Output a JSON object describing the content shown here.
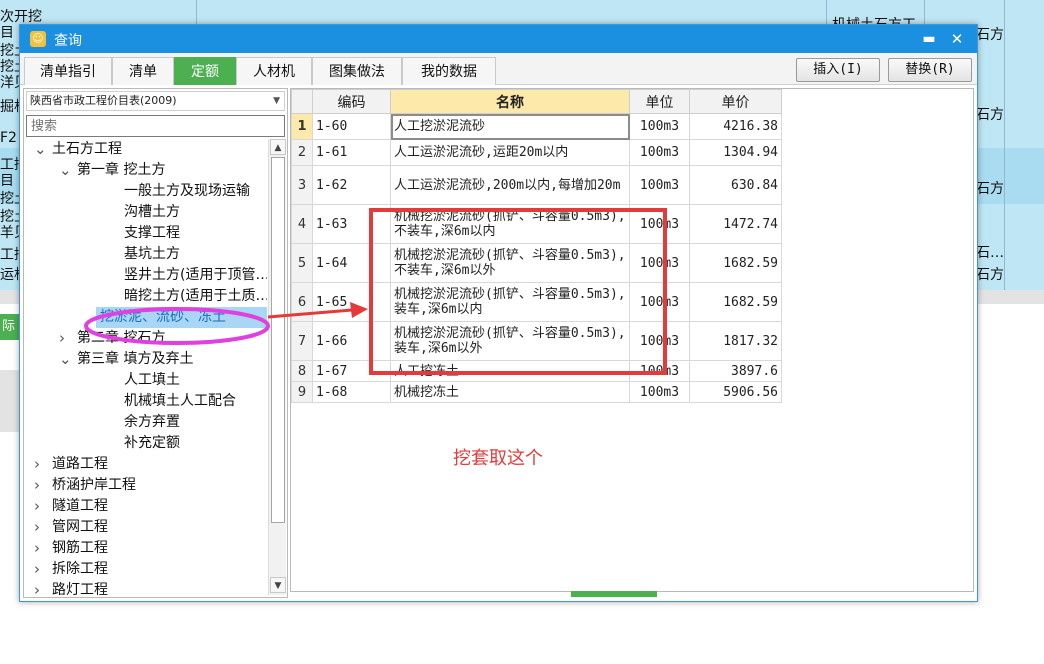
{
  "background": {
    "fragments": [
      {
        "text": "次开挖",
        "t": 6
      },
      {
        "text": "目",
        "t": 22
      },
      {
        "text": "挖土",
        "t": 40
      },
      {
        "text": "挖土",
        "t": 56
      },
      {
        "text": "洋贝",
        "t": 72
      },
      {
        "text": "掘机",
        "t": 96
      },
      {
        "text": "F2",
        "t": 130
      },
      {
        "text": "工挖",
        "t": 154
      },
      {
        "text": "目",
        "t": 170
      },
      {
        "text": "挖土",
        "t": 188
      },
      {
        "text": "挖土",
        "t": 206
      },
      {
        "text": "羊贝",
        "t": 222
      },
      {
        "text": "工挖",
        "t": 244
      },
      {
        "text": "运机",
        "t": 264
      }
    ],
    "right_labels": [
      "机械土石方工",
      "石方",
      "石方",
      "石方",
      "石方",
      "石…",
      "石方"
    ],
    "partial_button": "际"
  },
  "dialog": {
    "title": "查询",
    "tabs": [
      "清单指引",
      "清单",
      "定额",
      "人材机",
      "图集做法",
      "我的数据"
    ],
    "active_tab": 2,
    "insert_button": "插入(I)",
    "replace_button": "替换(R)",
    "library": "陕西省市政工程价目表(2009)",
    "search_placeholder": "搜索",
    "tree": [
      {
        "label": "土石方工程",
        "level": 0,
        "arrow": "open"
      },
      {
        "label": "第一章 挖土方",
        "level": 1,
        "arrow": "open"
      },
      {
        "label": "一般土方及现场运输",
        "level": 2,
        "arrow": "none"
      },
      {
        "label": "沟槽土方",
        "level": 2,
        "arrow": "none"
      },
      {
        "label": "支撑工程",
        "level": 2,
        "arrow": "none"
      },
      {
        "label": "基坑土方",
        "level": 2,
        "arrow": "none"
      },
      {
        "label": "竖井土方(适用于顶管…",
        "level": 2,
        "arrow": "none"
      },
      {
        "label": "暗挖土方(适用于土质…",
        "level": 2,
        "arrow": "none"
      },
      {
        "label": "挖淤泥、流砂、冻土",
        "level": 2,
        "arrow": "none",
        "selected": true
      },
      {
        "label": "第二章 挖石方",
        "level": 1,
        "arrow": "closed"
      },
      {
        "label": "第三章 填方及弃土",
        "level": 1,
        "arrow": "open"
      },
      {
        "label": "人工填土",
        "level": 2,
        "arrow": "none"
      },
      {
        "label": "机械填土人工配合",
        "level": 2,
        "arrow": "none"
      },
      {
        "label": "余方弃置",
        "level": 2,
        "arrow": "none"
      },
      {
        "label": "补充定额",
        "level": 2,
        "arrow": "none"
      },
      {
        "label": "道路工程",
        "level": 0,
        "arrow": "closed"
      },
      {
        "label": "桥涵护岸工程",
        "level": 0,
        "arrow": "closed"
      },
      {
        "label": "隧道工程",
        "level": 0,
        "arrow": "closed"
      },
      {
        "label": "管网工程",
        "level": 0,
        "arrow": "closed"
      },
      {
        "label": "钢筋工程",
        "level": 0,
        "arrow": "closed"
      },
      {
        "label": "拆除工程",
        "level": 0,
        "arrow": "closed"
      },
      {
        "label": "路灯工程",
        "level": 0,
        "arrow": "closed"
      }
    ],
    "grid": {
      "columns": [
        "编码",
        "名称",
        "单位",
        "单价"
      ],
      "rows": [
        {
          "no": "1",
          "code": "1-60",
          "name": "人工挖淤泥流砂",
          "unit": "100m3",
          "price": "4216.38"
        },
        {
          "no": "2",
          "code": "1-61",
          "name": "人工运淤泥流砂,运距20m以内",
          "unit": "100m3",
          "price": "1304.94"
        },
        {
          "no": "3",
          "code": "1-62",
          "name": "人工运淤泥流砂,200m以内,每增加20m",
          "unit": "100m3",
          "price": "630.84"
        },
        {
          "no": "4",
          "code": "1-63",
          "name": "机械挖淤泥流砂(抓铲、斗容量0.5m3),不装车,深6m以内",
          "unit": "100m3",
          "price": "1472.74"
        },
        {
          "no": "5",
          "code": "1-64",
          "name": "机械挖淤泥流砂(抓铲、斗容量0.5m3),不装车,深6m以外",
          "unit": "100m3",
          "price": "1682.59"
        },
        {
          "no": "6",
          "code": "1-65",
          "name": "机械挖淤泥流砂(抓铲、斗容量0.5m3),装车,深6m以内",
          "unit": "100m3",
          "price": "1682.59"
        },
        {
          "no": "7",
          "code": "1-66",
          "name": "机械挖淤泥流砂(抓铲、斗容量0.5m3),装车,深6m以外",
          "unit": "100m3",
          "price": "1817.32"
        },
        {
          "no": "8",
          "code": "1-67",
          "name": "人工挖冻土",
          "unit": "100m3",
          "price": "3897.6"
        },
        {
          "no": "9",
          "code": "1-68",
          "name": "机械挖冻土",
          "unit": "100m3",
          "price": "5906.56"
        }
      ]
    },
    "annotation": "挖套取这个",
    "colors": {
      "titlebar": "#1b8fe0",
      "active_tab": "#4caf50",
      "annotation": "#e53a3a",
      "ellipse": "#e040e0"
    }
  }
}
